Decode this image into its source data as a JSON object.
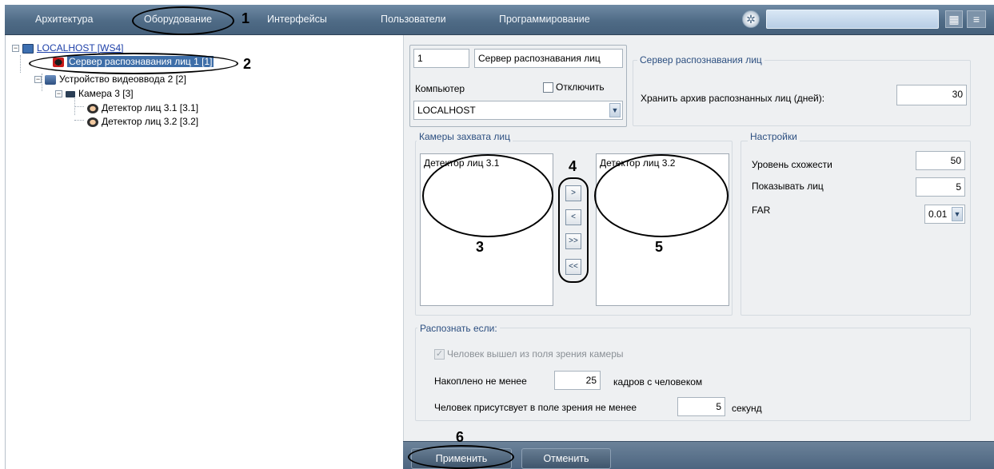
{
  "topbar": {
    "tabs": [
      {
        "label": "Архитектура"
      },
      {
        "label": "Оборудование"
      },
      {
        "label": "Интерфейсы"
      },
      {
        "label": "Пользователи"
      },
      {
        "label": "Программирование"
      }
    ],
    "search_value": ""
  },
  "tree": {
    "root": "LOCALHOST [WS4]",
    "server": "Сервер распознавания лиц 1 [1]",
    "video_device": "Устройство видеоввода 2 [2]",
    "camera": "Камера 3 [3]",
    "detector1": "Детектор лиц 3.1 [3.1]",
    "detector2": "Детектор лиц 3.2 [3.2]"
  },
  "form": {
    "id_value": "1",
    "name_value": "Сервер распознавания лиц",
    "computer_label": "Компьютер",
    "disable_label": "Отключить",
    "computer_value": "LOCALHOST",
    "server_group_title": "Сервер распознавания лиц",
    "archive_label": "Хранить архив распознанных лиц (дней):",
    "archive_value": "30",
    "cameras_group_title": "Камеры захвата лиц",
    "left_list_item": "Детектор лиц 3.1",
    "right_list_item": "Детектор лиц 3.2",
    "btn_add": ">",
    "btn_remove": "<",
    "btn_add_all": ">>",
    "btn_remove_all": "<<",
    "settings_group_title": "Настройки",
    "similarity_label": "Уровень схожести",
    "similarity_value": "50",
    "show_faces_label": "Показывать лиц",
    "show_faces_value": "5",
    "far_label": "FAR",
    "far_value": "0.01",
    "recognize_group_title": "Распознать если:",
    "left_fov_label": "Человек вышел из поля зрения камеры",
    "left_fov_checked": true,
    "accumulated_label": "Накоплено не менее",
    "accumulated_value": "25",
    "frames_label": "кадров с человеком",
    "present_label": "Человек присутсвует в поле зрения не менее",
    "present_value": "5",
    "seconds_label": "секунд"
  },
  "bottombar": {
    "apply_label": "Применить",
    "cancel_label": "Отменить"
  },
  "annotations": [
    "1",
    "2",
    "3",
    "4",
    "5",
    "6"
  ],
  "colors": {
    "topbar": "#4f6b86",
    "panel_bg": "#eef0f2",
    "group_title": "#2c4f80"
  }
}
